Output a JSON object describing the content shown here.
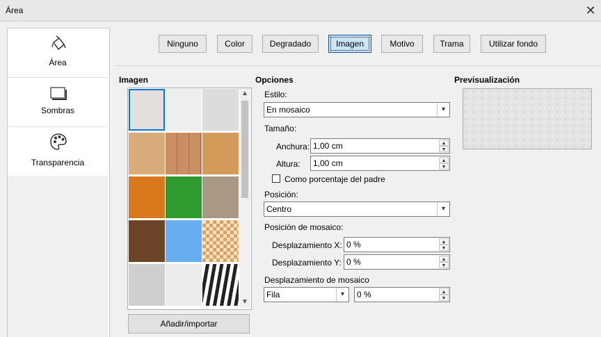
{
  "window": {
    "title": "Área"
  },
  "sidebar": {
    "items": [
      {
        "label": "Área",
        "icon": "paint-bucket-icon"
      },
      {
        "label": "Sombras",
        "icon": "shadow-icon"
      },
      {
        "label": "Transparencia",
        "icon": "palette-icon"
      }
    ]
  },
  "fill_tabs": [
    "Ninguno",
    "Color",
    "Degradado",
    "Imagen",
    "Motivo",
    "Trama",
    "Utilizar fondo"
  ],
  "selected_tab": "Imagen",
  "image_section": {
    "title": "Imagen",
    "tiles": [
      {
        "name": "painted-white",
        "color": "#e4dfdc"
      },
      {
        "name": "paper-texture",
        "color": "#eeeeee"
      },
      {
        "name": "paper-crumpled",
        "color": "#dcdcdc"
      },
      {
        "name": "wood-light",
        "color": "#d8ad7b"
      },
      {
        "name": "wood-planks",
        "color": "#c98f63"
      },
      {
        "name": "wood-grain",
        "color": "#d39b5a"
      },
      {
        "name": "autumn-leaves",
        "color": "#d9781d"
      },
      {
        "name": "grass",
        "color": "#2f9a2f"
      },
      {
        "name": "pebbles",
        "color": "#a99883"
      },
      {
        "name": "coffee-beans",
        "color": "#6c4326"
      },
      {
        "name": "sky-clouds",
        "color": "#66aef0"
      },
      {
        "name": "mosaic-tiles",
        "color": "#e8c39a"
      },
      {
        "name": "concrete",
        "color": "#cfcfcf"
      },
      {
        "name": "fabric-white",
        "color": "#ececec"
      },
      {
        "name": "zebra",
        "color": "#333333"
      }
    ],
    "add_button": "Añadir/importar"
  },
  "options": {
    "title": "Opciones",
    "style_label": "Estilo:",
    "style_value": "En mosaico",
    "size_label": "Tamaño:",
    "width_label": "Anchura:",
    "width_value": "1,00 cm",
    "height_label": "Altura:",
    "height_value": "1,00 cm",
    "relative_label": "Como porcentaje del padre",
    "position_label": "Posición:",
    "position_value": "Centro",
    "tile_position_label": "Posición de mosaico:",
    "x_offset_label": "Desplazamiento X:",
    "x_offset_value": "0 %",
    "y_offset_label": "Desplazamiento Y:",
    "y_offset_value": "0 %",
    "tile_offset_label": "Desplazamiento de mosaico",
    "tile_offset_mode": "Fila",
    "tile_offset_value": "0 %"
  },
  "preview": {
    "title": "Previsualización"
  }
}
